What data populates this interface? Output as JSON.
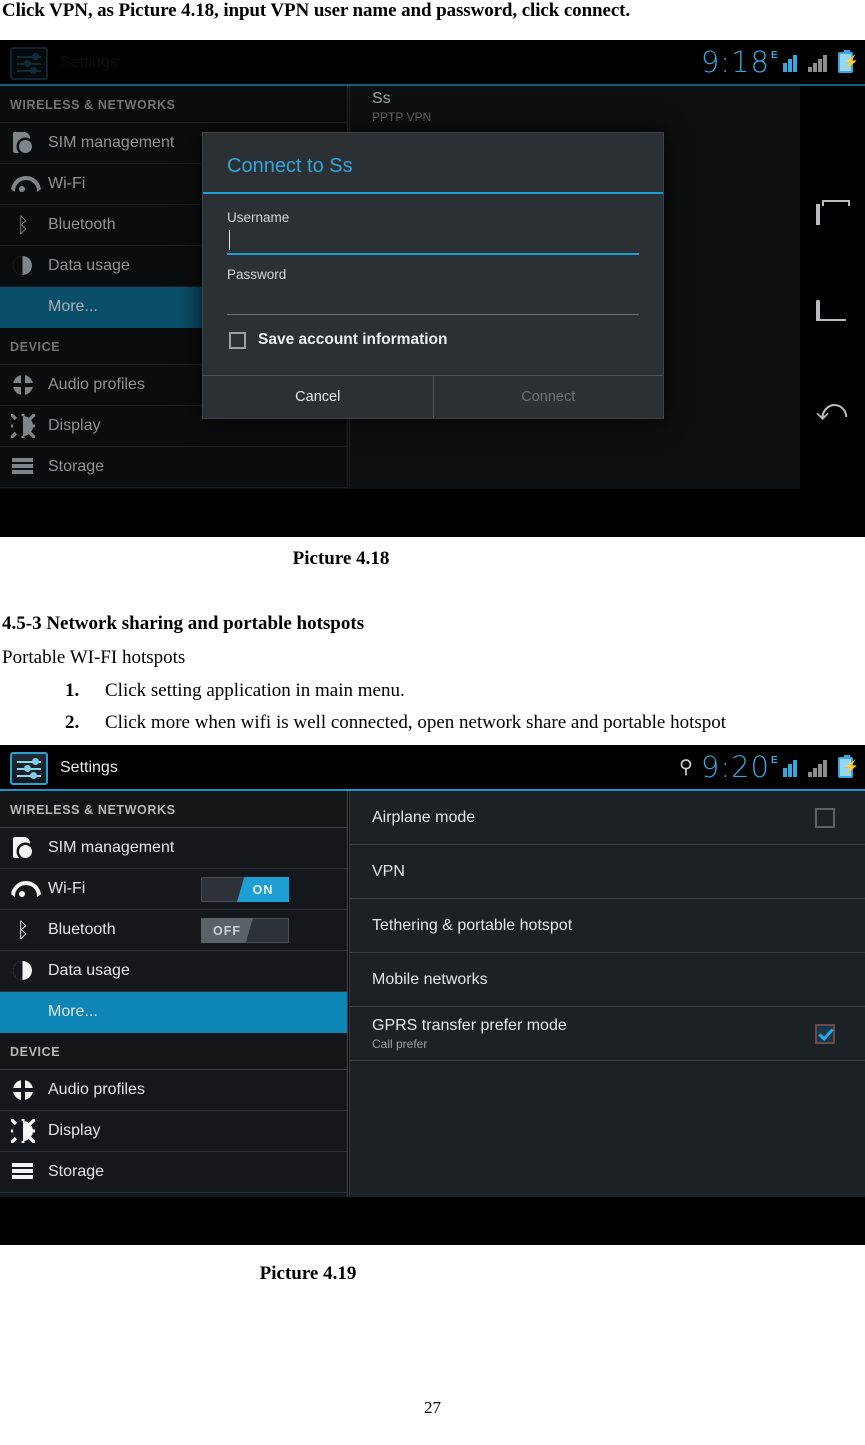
{
  "document": {
    "intro_line": "Click VPN, as Picture 4.18, input VPN user name and password, click connect.",
    "caption_418": "Picture 4.18",
    "heading_453": "4.5-3 Network sharing and portable hotspots",
    "sub_portable": "Portable WI-FI hotspots",
    "list": [
      {
        "num": "1.",
        "text": "Click setting application in main menu."
      },
      {
        "num": "2.",
        "text": "Click more when wifi is well connected, open network share and portable hotspot"
      }
    ],
    "caption_419": "Picture 4.19",
    "page_number": "27"
  },
  "shot1": {
    "statusbar": {
      "app_title": "Settings",
      "settings_icon": "settings-sliders-icon",
      "clock": "9:18",
      "signal_tag": "E",
      "icons": [
        "signal-bars-icon",
        "signal-bars-secondary-icon",
        "battery-charging-icon"
      ]
    },
    "sidebar": {
      "group_wireless": "WIRELESS & NETWORKS",
      "group_device": "DEVICE",
      "items": [
        {
          "label": "SIM management",
          "icon": "sim-card-icon"
        },
        {
          "label": "Wi-Fi",
          "icon": "wifi-icon"
        },
        {
          "label": "Bluetooth",
          "icon": "bluetooth-icon"
        },
        {
          "label": "Data usage",
          "icon": "data-usage-pie-icon"
        },
        {
          "label": "More...",
          "icon": "none",
          "selected": true
        },
        {
          "label": "Audio profiles",
          "icon": "audio-profiles-icon"
        },
        {
          "label": "Display",
          "icon": "display-brightness-icon"
        },
        {
          "label": "Storage",
          "icon": "storage-stack-icon"
        }
      ]
    },
    "vpn_entry": {
      "name": "Ss",
      "type": "PPTP VPN"
    },
    "dialog": {
      "title": "Connect to Ss",
      "username_label": "Username",
      "username_value": "",
      "password_label": "Password",
      "password_value": "",
      "save_checkbox_label": "Save account information",
      "save_checkbox_checked": false,
      "cancel_label": "Cancel",
      "connect_label": "Connect"
    },
    "softkeys": [
      {
        "name": "recent-apps-icon"
      },
      {
        "name": "home-icon"
      },
      {
        "name": "back-icon"
      }
    ]
  },
  "shot2": {
    "statusbar": {
      "app_title": "Settings",
      "settings_icon": "settings-sliders-icon",
      "usb_icon": "usb-icon",
      "clock": "9:20",
      "signal_tag": "E",
      "icons": [
        "signal-bars-icon",
        "signal-bars-secondary-icon",
        "battery-charging-icon"
      ]
    },
    "sidebar": {
      "group_wireless": "WIRELESS & NETWORKS",
      "group_device": "DEVICE",
      "items": [
        {
          "label": "SIM management",
          "icon": "sim-card-icon"
        },
        {
          "label": "Wi-Fi",
          "icon": "wifi-icon",
          "toggle": "ON"
        },
        {
          "label": "Bluetooth",
          "icon": "bluetooth-icon",
          "toggle": "OFF"
        },
        {
          "label": "Data usage",
          "icon": "data-usage-pie-icon"
        },
        {
          "label": "More...",
          "icon": "none",
          "selected": true
        },
        {
          "label": "Audio profiles",
          "icon": "audio-profiles-icon"
        },
        {
          "label": "Display",
          "icon": "display-brightness-icon"
        },
        {
          "label": "Storage",
          "icon": "storage-stack-icon"
        }
      ]
    },
    "panel": {
      "rows": [
        {
          "label": "Airplane mode",
          "sub": "",
          "checkbox": "unchecked"
        },
        {
          "label": "VPN",
          "sub": "",
          "checkbox": "none"
        },
        {
          "label": "Tethering & portable hotspot",
          "sub": "",
          "checkbox": "none"
        },
        {
          "label": "Mobile networks",
          "sub": "",
          "checkbox": "none"
        },
        {
          "label": "GPRS transfer prefer mode",
          "sub": "Call prefer",
          "checkbox": "checked"
        }
      ]
    }
  },
  "colors": {
    "accent_blue": "#1d9fd4",
    "selected_row": "#0d85b5",
    "status_text": "#37a8dd",
    "panel_bg": "#1c2126",
    "sidebar_bg": "#14181c"
  }
}
